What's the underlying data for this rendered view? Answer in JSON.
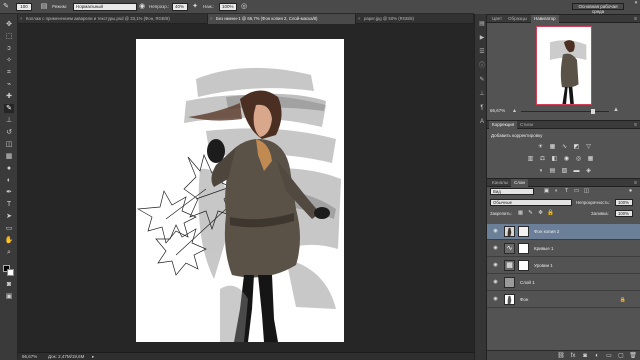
{
  "menubar": {
    "workspace": "Основная рабочая среда",
    "controls": [
      "–",
      "▢",
      "✕"
    ]
  },
  "options_bar": {
    "size_value": "100",
    "mode_label": "Режим:",
    "mode_value": "Нормальный",
    "opacity_label": "Непрозр.:",
    "opacity_value": "40%",
    "press_label": "Наж.:",
    "press_value": "100%"
  },
  "doc_tabs": [
    {
      "label": "Коллаж с применением акварели и текстуры.psd @ 33,1% (Фон, RGB/8)"
    },
    {
      "label": "Без имени-1 @ 66,7% (Фон копия 2, Слой-маска/8)"
    },
    {
      "label": "paper.jpg @ 50% (RGB/8)"
    }
  ],
  "status": {
    "zoom": "66,67%",
    "doc": "Док: 2,47M/19,6M"
  },
  "navigator": {
    "tabs": [
      "Цвет",
      "Образцы",
      "Навигатор"
    ],
    "zoom": "66,67%"
  },
  "adjustments": {
    "tabs": [
      "Коррекция",
      "Стили"
    ],
    "title": "Добавить корректировку"
  },
  "layers": {
    "tabs": [
      "Каналы",
      "Слои"
    ],
    "filter_kind": "Вид",
    "blend_mode": "Обычные",
    "opacity_label": "Непрозрачность:",
    "opacity_value": "100%",
    "lock_label": "Закрепить:",
    "fill_label": "Заливка:",
    "fill_value": "100%",
    "items": [
      {
        "name": "Фон копия 2",
        "selected": true
      },
      {
        "name": "Кривые 1",
        "selected": false
      },
      {
        "name": "Уровни 1",
        "selected": false
      },
      {
        "name": "Слой 1",
        "selected": false
      },
      {
        "name": "Фон",
        "selected": false
      }
    ]
  }
}
